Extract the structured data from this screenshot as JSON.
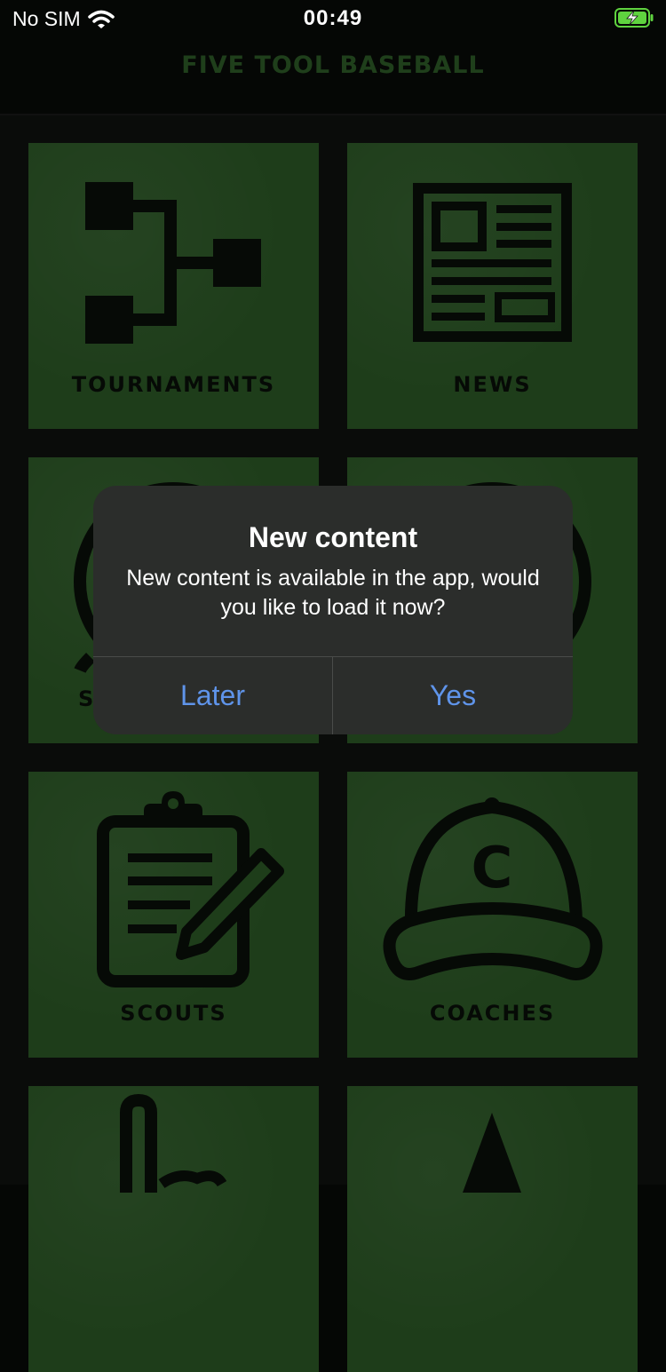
{
  "status_bar": {
    "carrier": "No SIM",
    "time": "00:49"
  },
  "nav": {
    "title": "FIVE TOOL BASEBALL"
  },
  "tiles": [
    {
      "label": "TOURNAMENTS",
      "icon": "bracket-icon"
    },
    {
      "label": "NEWS",
      "icon": "newspaper-icon"
    },
    {
      "label": "S",
      "icon": "ball-icon"
    },
    {
      "label": "",
      "icon": "ball-icon"
    },
    {
      "label": "SCOUTS",
      "icon": "clipboard-icon"
    },
    {
      "label": "COACHES",
      "icon": "cap-icon"
    },
    {
      "label": "",
      "icon": "foam-finger-icon"
    },
    {
      "label": "",
      "icon": "cone-icon"
    }
  ],
  "alert": {
    "title": "New content",
    "message": "New content is available in the app, would you like to load it now?",
    "later_label": "Later",
    "yes_label": "Yes"
  },
  "colors": {
    "tile": "#1e3d1a",
    "accent": "#5f94ea"
  }
}
